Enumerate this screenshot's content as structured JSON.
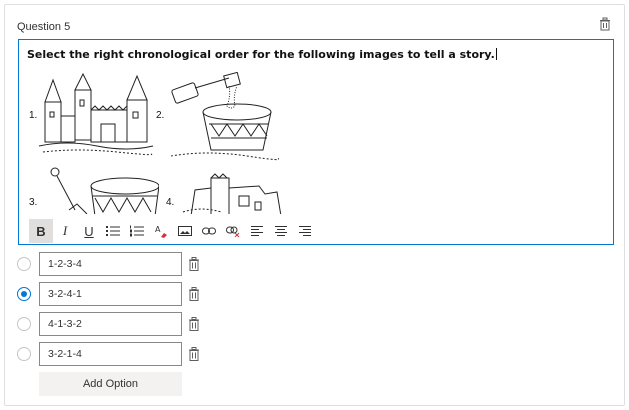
{
  "question": {
    "label": "Question 5",
    "prompt": "Select the right chronological order for the following images to tell a story.",
    "image_numbers": [
      "1.",
      "2.",
      "3.",
      "4."
    ]
  },
  "toolbar": {
    "bold_label": "B",
    "italic_label": "I",
    "underline_label": "U",
    "icons": [
      "bold-icon",
      "italic-icon",
      "underline-icon",
      "bullet-list-icon",
      "numbered-list-icon",
      "font-color-icon",
      "image-icon",
      "link-icon",
      "unlink-icon",
      "align-left-icon",
      "align-center-icon",
      "align-right-icon"
    ]
  },
  "options": [
    {
      "value": "1-2-3-4",
      "selected": false
    },
    {
      "value": "3-2-4-1",
      "selected": true
    },
    {
      "value": "4-1-3-2",
      "selected": false
    },
    {
      "value": "3-2-1-4",
      "selected": false
    }
  ],
  "add_option_label": "Add Option",
  "colors": {
    "accent": "#0078d4",
    "border": "#e1dfdd"
  }
}
